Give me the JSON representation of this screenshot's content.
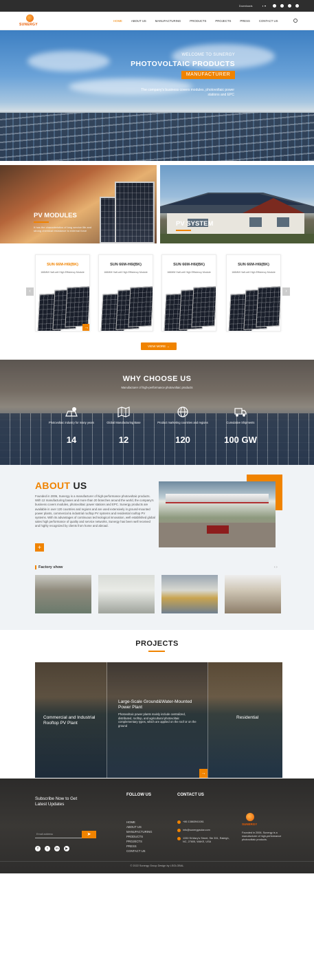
{
  "topbar": {
    "downloads": "Downloads",
    "lang_icon": "globe-icon",
    "social_icons": [
      "facebook-icon",
      "twitter-icon",
      "linkedin-icon",
      "youtube-icon"
    ]
  },
  "brand": {
    "name": "SUNERGY",
    "accent": "#f08300"
  },
  "nav": {
    "items": [
      "HOME",
      "ABOUT US",
      "MANUFACTURING",
      "PRODUCTS",
      "PROJECTS",
      "PRESS",
      "CONTACT US"
    ],
    "active": "HOME",
    "search_icon": "search-icon"
  },
  "hero": {
    "welcome": "WELCOME TO SUNERGY",
    "title": "PHOTOVOLTAIC PRODUCTS",
    "tag": "MANUFACTURER",
    "desc": "The company's business covers modules, photovoltaic power stations and EPC"
  },
  "categories": [
    {
      "title": "PV MODULES",
      "desc": "It has the characteristics of long service life and strong chemical resistance to external force"
    },
    {
      "title": "PV SYSTEM"
    }
  ],
  "products": [
    {
      "name": "SUN 66M-H6I(BK)",
      "desc": "166MM Half-cell High Efficiency Module",
      "active": true
    },
    {
      "name": "SUN 66M-H6I(BK)",
      "desc": "166MM Half-cell High Efficiency Module",
      "active": false
    },
    {
      "name": "SUN 66M-H6I(BK)",
      "desc": "166MM Half-cell High Efficiency Module",
      "active": false
    },
    {
      "name": "SUN 66M-H6I(BK)",
      "desc": "166MM Half-cell High Efficiency Module",
      "active": false
    }
  ],
  "carousel": {
    "prev": "‹",
    "next": "›",
    "go": "→"
  },
  "view_more": "VIEW MORE →",
  "why": {
    "title": "WHY CHOOSE US",
    "subtitle": "Manufacturer of high-performance photovoltaic products",
    "stats": [
      {
        "icon": "solar-panel-icon",
        "label": "Photovoltaic industry for many years",
        "value": "14"
      },
      {
        "icon": "map-icon",
        "label": "Global Manufacturing Base",
        "value": "12"
      },
      {
        "icon": "globe-icon",
        "label": "Product marketing countries and regions",
        "value": "120"
      },
      {
        "icon": "truck-icon",
        "label": "Cumulative Shipments",
        "value": "100 GW"
      }
    ]
  },
  "about": {
    "title_a": "ABOUT",
    "title_b": "US",
    "text": "Founded in 2006, Sunergy is a manufacturer of high-performance photovoltaic products. With 12 manufacturing bases and more than 20 branches around the world, the company's business covers modules, photovoltaic power stations and EPC. Sunergy products are available in over 120 countries and regions and are used extensively in ground-mounted power plants, commercial & industrial rooftop PV systems and residential rooftop PV systems. With its advantages of continuous technological innovation, well established global sales high performance of quality and service networks, Sunergy has been well received and highly recognized by clients from home and abroad.",
    "more": "+",
    "factory_label": "Factory show",
    "pager": "‹  ›"
  },
  "projects": {
    "title": "PROJECTS",
    "items": [
      {
        "title": "Commercial and Industrial Rooftop PV Plant",
        "desc": ""
      },
      {
        "title": "Large-Scale Ground&Water-Mounted Power Plant",
        "desc": "Photovoltaic power plants mainly include centralized, distributed, rooftop, and agricultural photovoltaic complementary types, which are applied on the roof or on the ground"
      },
      {
        "title": "Residential",
        "desc": ""
      }
    ],
    "go": "→"
  },
  "footer": {
    "subscribe": "Subscribe Now to Get Latest Updates",
    "email_placeholder": "Email address",
    "send_icon": "send-icon",
    "social": [
      "f",
      "t",
      "in",
      "▶"
    ],
    "follow_title": "FOLLOW US",
    "links": [
      "HOME",
      "ABOUT US",
      "MANUFACTURING",
      "PRODUCTS",
      "PROJECTS",
      "PRESS",
      "CONTACT US"
    ],
    "contact_title": "CONTACT US",
    "phone": "+86 13863941081",
    "email": "info@sunergysolar.com",
    "address": "1330 St.Mary's Street, Ste 331, Raleigh, NC, 27605, WAKE, USA",
    "logo": "SUNERGY",
    "desc": "Founded in 2006, Sunergy is a manufacturer of high-performance photovoltaic products.",
    "copyright": "© 2022 Sunergy Group Design by LSGLOBAL"
  }
}
